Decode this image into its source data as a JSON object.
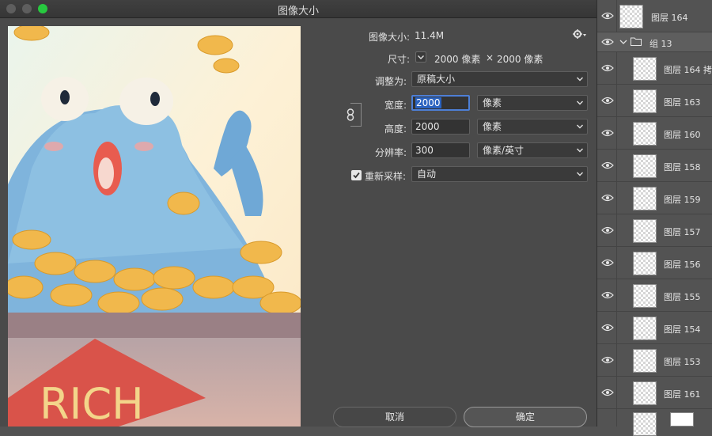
{
  "dialog": {
    "title": "图像大小",
    "image_size_label": "图像大小:",
    "image_size_value": "11.4M",
    "dimensions_label": "尺寸:",
    "dimensions_width": "2000 像素",
    "dimensions_times": "×",
    "dimensions_height": "2000 像素",
    "fit_to_label": "调整为:",
    "fit_to_value": "原稿大小",
    "width_label": "宽度:",
    "width_value": "2000",
    "width_unit": "像素",
    "height_label": "高度:",
    "height_value": "2000",
    "height_unit": "像素",
    "resolution_label": "分辨率:",
    "resolution_value": "300",
    "resolution_unit": "像素/英寸",
    "resample_label": "重新采样:",
    "resample_checked": true,
    "resample_value": "自动",
    "cancel_label": "取消",
    "ok_label": "确定"
  },
  "preview": {
    "caption": "RICH"
  },
  "layers": {
    "items": [
      {
        "name": "图层 164",
        "indent": false
      },
      {
        "name": "组 13",
        "group": true
      },
      {
        "name": "图层 164 拷",
        "indent": true
      },
      {
        "name": "图层 163",
        "indent": true
      },
      {
        "name": "图层 160",
        "indent": true
      },
      {
        "name": "图层 158",
        "indent": true
      },
      {
        "name": "图层 159",
        "indent": true
      },
      {
        "name": "图层 157",
        "indent": true
      },
      {
        "name": "图层 156",
        "indent": true
      },
      {
        "name": "图层 155",
        "indent": true
      },
      {
        "name": "图层 154",
        "indent": true
      },
      {
        "name": "图层 153",
        "indent": true
      },
      {
        "name": "图层 161",
        "indent": true
      }
    ]
  },
  "colors": {
    "accent": "#4d7fd6",
    "max_button": "#27c93f"
  }
}
